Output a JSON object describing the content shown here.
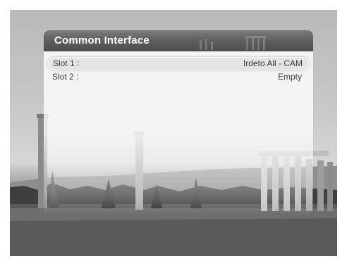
{
  "panel": {
    "title": "Common Interface"
  },
  "slots": [
    {
      "label": "Slot 1 :",
      "value": "Irdeto All - CAM",
      "selected": true
    },
    {
      "label": "Slot 2 :",
      "value": "Empty",
      "selected": false
    }
  ],
  "colors": {
    "header": "#5f5f5f",
    "title_text": "#ffffff",
    "row_text": "#3a3a3a",
    "selection_border": "#ffffff"
  }
}
